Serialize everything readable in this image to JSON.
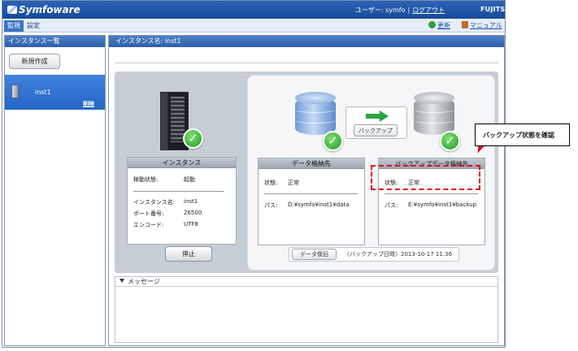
{
  "header": {
    "logo_text": "Symfoware",
    "user_label": "ユーザー: symfo",
    "separator": "|",
    "logout_label": "ログアウト",
    "vendor": "FUJITSU"
  },
  "menu": {
    "tabs": [
      {
        "label": "監視",
        "active": true
      },
      {
        "label": "設定",
        "active": false
      }
    ],
    "refresh_label": "更新",
    "manual_label": "マニュアル"
  },
  "sidebar": {
    "title": "インスタンス一覧",
    "new_button": "新規作成",
    "instances": [
      {
        "name": "inst1",
        "delete_label": "削除"
      }
    ]
  },
  "main": {
    "title": "インスタンス名: inst1",
    "instance_card": {
      "title": "インスタンス",
      "status_label": "稼動状態:",
      "status_value": "起動",
      "name_label": "インスタンス名:",
      "name_value": "inst1",
      "port_label": "ポート番号:",
      "port_value": "26500",
      "encoding_label": "エンコード:",
      "encoding_value": "UTF8"
    },
    "stop_button": "停止",
    "data_card": {
      "title": "データ格納先",
      "status_label": "状態:",
      "status_value": "正常",
      "path_label": "パス:",
      "path_value": "D:¥symfo¥inst1¥data"
    },
    "backup_button": "バックアップ",
    "backup_card": {
      "title": "バックアップデータ格納先",
      "status_label": "状態:",
      "status_value": "正常",
      "path_label": "パス:",
      "path_value": "E:¥symfo¥inst1¥backup"
    },
    "restore_button": "データ復旧",
    "backup_datetime": "〈バックアップ日時〉2013-10-17 11:36",
    "messages_title": "メッセージ"
  },
  "annotation": {
    "callout_text": "バックアップ状態を確認",
    "highlight_color": "#e4001b"
  },
  "colors": {
    "header_blue": "#174a98",
    "selected_item": "#2566c6",
    "check_green": "#1f9a2b",
    "arrow_green": "#27a342"
  }
}
